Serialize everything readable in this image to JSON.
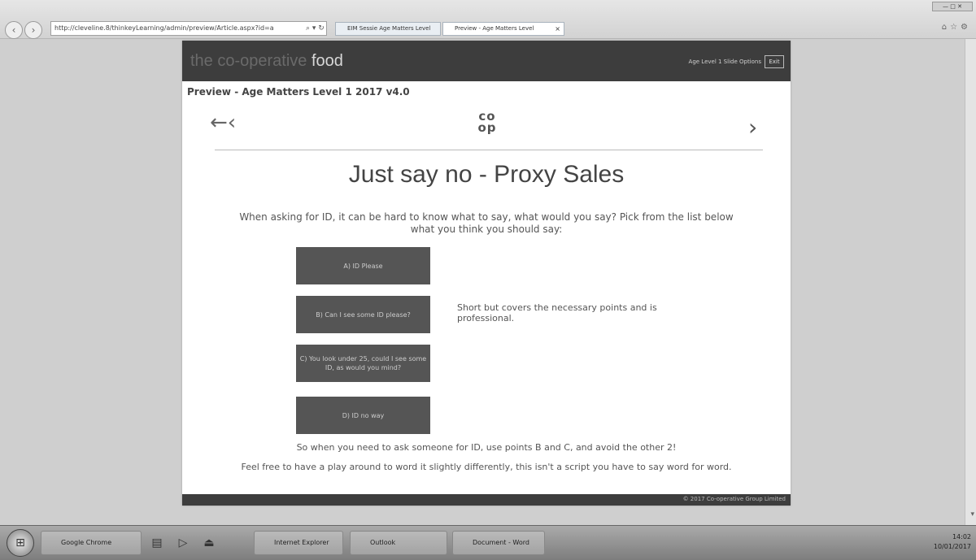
{
  "browser": {
    "address": "http://cleveline.8/thinkeyLearning/admin/preview/Article.aspx?id=a",
    "tabs": [
      "EIM Sessie Age Matters Level",
      "Preview - Age Matters Level"
    ],
    "tab_close": "×"
  },
  "app": {
    "brand_prefix": "the co-operative",
    "brand_food": "food",
    "header_link": "Age Level 1 Slide Options",
    "exit_label": "Exit",
    "preview_title": "Preview - Age Matters Level 1 2017 v4.0",
    "logo_top": "co",
    "logo_bottom": "op",
    "arrow_left": "←‹",
    "arrow_right": "›",
    "slide_title": "Just say no - Proxy Sales",
    "instruction": "When asking for ID, it can be hard to know what to say, what would you say? Pick from the list below what you think you should say:",
    "options": [
      "A) ID Please",
      "B) Can I see some ID please?",
      "C) You look under 25, could I see some ID, as would you mind?",
      "D) ID no way"
    ],
    "feedback": "Short but covers the necessary points and is professional.",
    "summary": "So when you need to ask someone for ID, use points B and C, and avoid the other 2!",
    "note": "Feel free to have a play around to word it slightly differently, this isn't a script you have to say word for word.",
    "footer": "© 2017 Co-operative Group Limited"
  },
  "taskbar": {
    "items": [
      "Google Chrome",
      "Windows Explorer",
      "Internet Explorer",
      "Outlook",
      "Document - Word"
    ],
    "time": "14:02",
    "date": "10/01/2017"
  }
}
